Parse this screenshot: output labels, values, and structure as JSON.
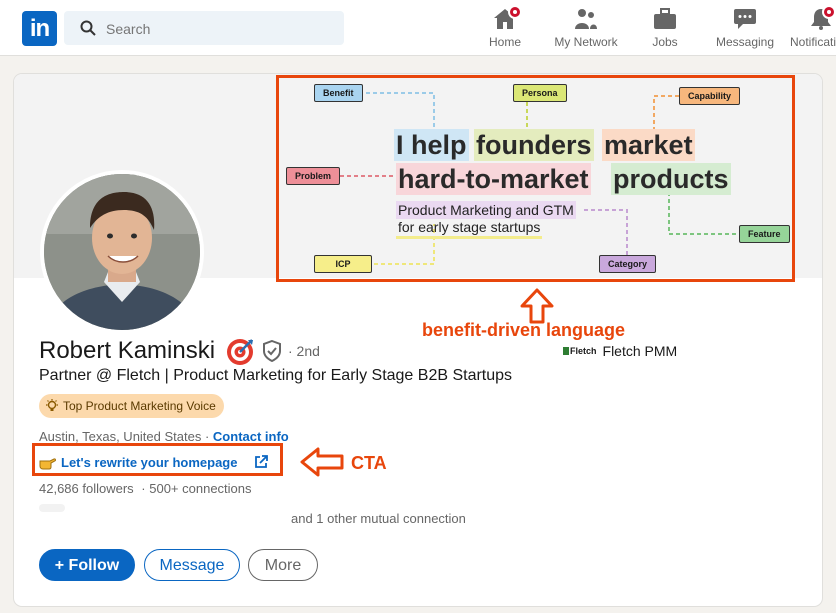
{
  "nav": {
    "search_placeholder": "Search",
    "items": [
      {
        "label": "Home",
        "icon": "home-icon"
      },
      {
        "label": "My Network",
        "icon": "network-icon"
      },
      {
        "label": "Jobs",
        "icon": "briefcase-icon"
      },
      {
        "label": "Messaging",
        "icon": "chat-icon"
      },
      {
        "label": "Notifications",
        "icon": "bell-icon"
      }
    ]
  },
  "banner": {
    "headline_parts": [
      "I help",
      "founders",
      "market",
      "hard-to-market",
      "products"
    ],
    "sub_1": "Product Marketing and GTM",
    "sub_2": "for early stage startups",
    "tags": {
      "benefit": "Benefit",
      "persona": "Persona",
      "capability": "Capability",
      "problem": "Problem",
      "feature": "Feature",
      "icp": "ICP",
      "category": "Category"
    }
  },
  "annotations": {
    "benefit": "benefit-driven language",
    "cta": "CTA"
  },
  "profile": {
    "name": "Robert Kaminski",
    "degree": "· 2nd",
    "headline": "Partner @ Fletch | Product Marketing for Early Stage B2B Startups",
    "voice_badge": "Top Product Marketing Voice",
    "location": "Austin, Texas, United States",
    "location_sep": " · ",
    "contact_info": "Contact info",
    "website": "Let's rewrite your homepage",
    "followers": "42,686 followers",
    "connections": "· 500+ connections",
    "mutual": "and 1 other mutual connection",
    "company_logo": "Fletch",
    "company": "Fletch PMM"
  },
  "actions": {
    "follow": "+ Follow",
    "message": "Message",
    "more": "More"
  },
  "colors": {
    "brand": "#0a66c2",
    "annotation": "#e8460c"
  }
}
